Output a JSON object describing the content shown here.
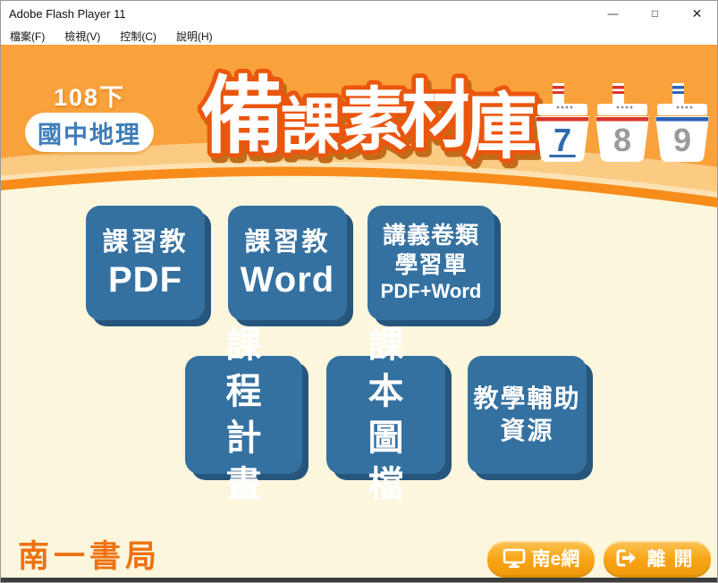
{
  "window": {
    "title": "Adobe Flash Player 11",
    "minimize_icon": "—",
    "maximize_icon": "□",
    "close_icon": "✕"
  },
  "menu": {
    "items": [
      "檔案(F)",
      "檢視(V)",
      "控制(C)",
      "說明(H)"
    ]
  },
  "header": {
    "semester": "108下",
    "subject": "國中地理",
    "title_chars": [
      "備",
      "課",
      "素",
      "材",
      "庫"
    ],
    "boats": [
      {
        "number": "7",
        "stripe_color": "#D8372B",
        "number_color": "#2F6CAD",
        "selected": true
      },
      {
        "number": "8",
        "stripe_color": "#D8372B",
        "number_color": "#9B9B9B",
        "selected": false
      },
      {
        "number": "9",
        "stripe_color": "#2E63B5",
        "number_color": "#9B9B9B",
        "selected": false
      }
    ]
  },
  "main_buttons": {
    "row1": [
      {
        "lines": [
          "課習教",
          "PDF"
        ]
      },
      {
        "lines": [
          "課習教",
          "Word"
        ]
      },
      {
        "lines": [
          "講義卷類",
          "學習單",
          "PDF+Word"
        ]
      }
    ],
    "row2": [
      {
        "lines": [
          "課程",
          "計畫"
        ]
      },
      {
        "lines": [
          "課本",
          "圖檔"
        ]
      },
      {
        "lines": [
          "教學輔助",
          "資源"
        ]
      }
    ]
  },
  "footer": {
    "brand": "南一書局",
    "nan_e_net_label": "南e網",
    "exit_label": "離開"
  },
  "colors": {
    "header_orange": "#F9A23C",
    "body_cream": "#FCF6DC",
    "button_blue": "#3471A1",
    "button_blue_shadow": "#27567D",
    "accent_orange": "#F7A414",
    "title_outline": "#EB560E"
  }
}
